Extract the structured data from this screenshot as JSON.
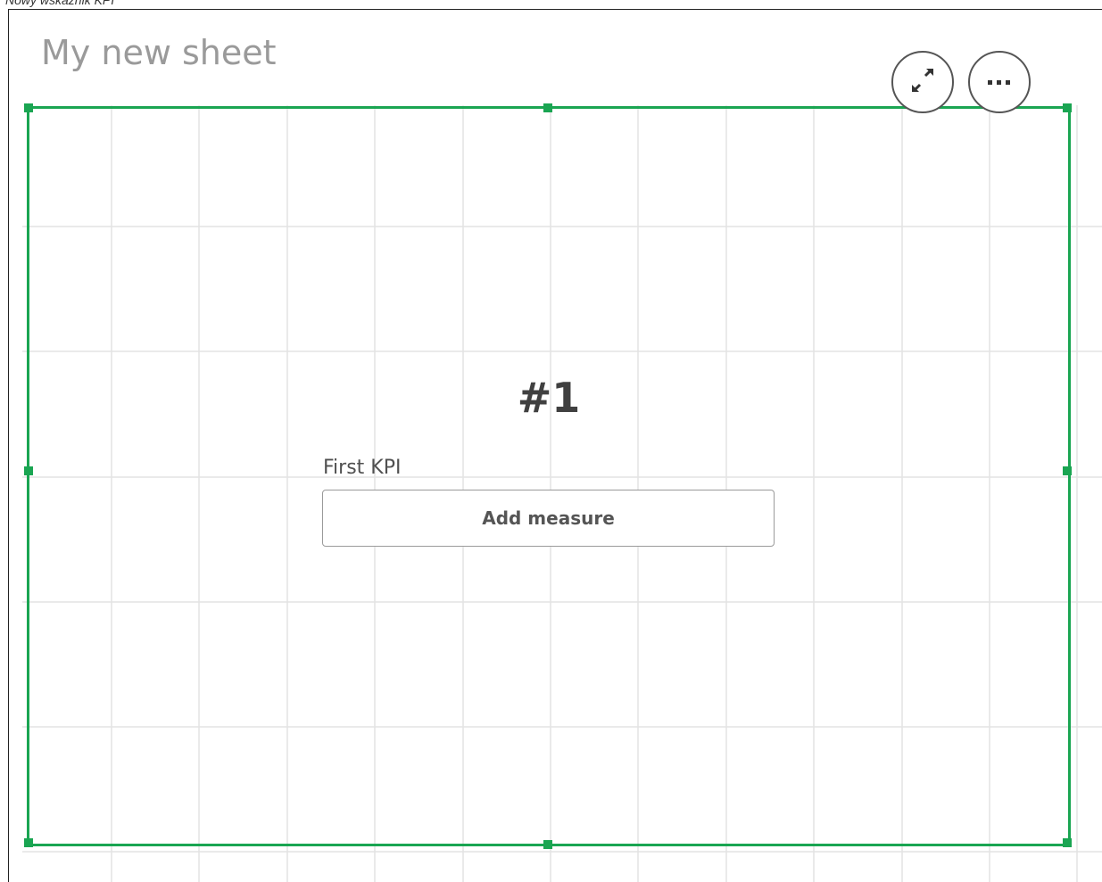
{
  "caption": "Nowy wskaźnik KPI",
  "sheet": {
    "title": "My new sheet"
  },
  "toolbar": {
    "expand_icon": "expand-arrows-icon",
    "more_icon": "more-dots-icon",
    "more_glyph": "•••"
  },
  "kpi": {
    "number": "#1",
    "label": "First KPI",
    "add_measure_label": "Add measure"
  },
  "colors": {
    "selection": "#1aa552",
    "grid": "#e3e3e3",
    "title": "#9a9a9a"
  }
}
